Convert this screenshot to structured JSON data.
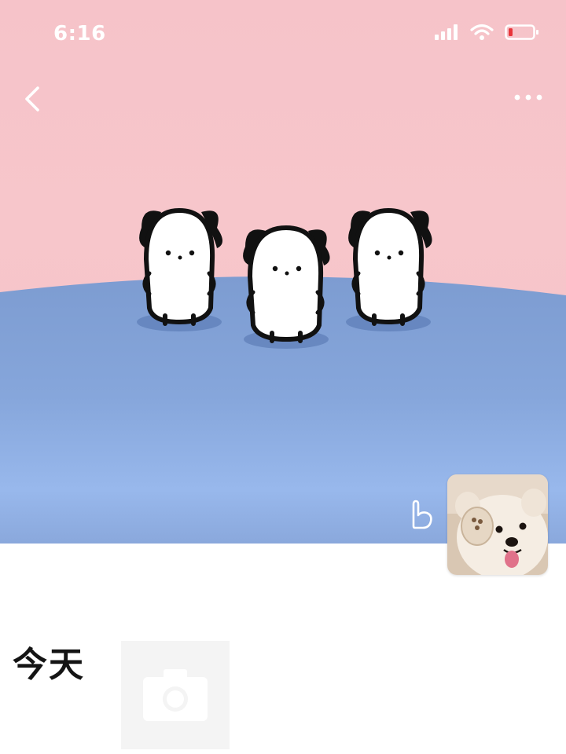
{
  "status_bar": {
    "time": "6:16",
    "icons": [
      "signal-icon",
      "wifi-icon",
      "battery-low-icon"
    ]
  },
  "nav": {
    "back_icon": "chevron-left-icon",
    "more_icon": "more-dots-icon"
  },
  "cover": {
    "sky_color": "#f6c3c9",
    "ground_color": "#7f9fd3",
    "characters": 3
  },
  "profile": {
    "like_icon": "hand-like-icon",
    "avatar_icon": "dog-avatar"
  },
  "timeline": {
    "day_label": "今天",
    "post_tile_icon": "camera-icon"
  }
}
